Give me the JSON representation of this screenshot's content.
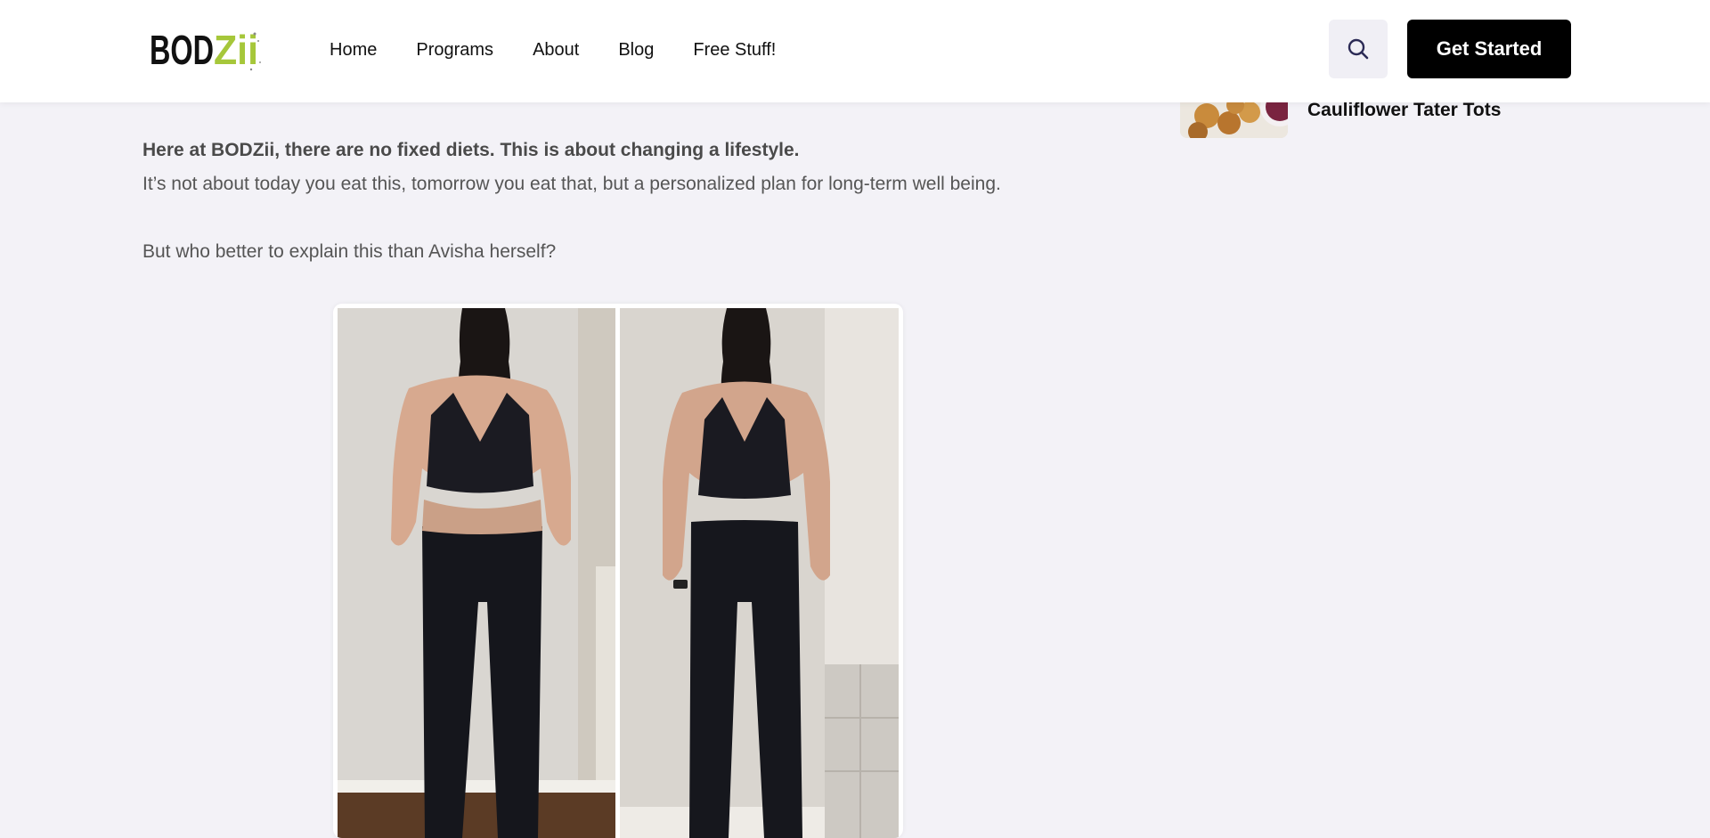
{
  "header": {
    "logo_text": "BODZii",
    "nav": [
      {
        "label": "Home"
      },
      {
        "label": "Programs"
      },
      {
        "label": "About"
      },
      {
        "label": "Blog"
      },
      {
        "label": "Free Stuff!"
      }
    ],
    "search_icon": "search-icon",
    "cta_label": "Get Started"
  },
  "sidebar": {
    "recipe": {
      "title": "Cauliflower Tater Tots"
    }
  },
  "article": {
    "intro_bold": "Here at BODZii, there are no fixed diets. This is about changing a lifestyle.",
    "intro_text": "It’s not about today you eat this, tomorrow you eat that, but a personalized plan for long-term well being.",
    "question": "But who better to explain this than Avisha herself?"
  },
  "colors": {
    "logo_accent": "#a6c73a",
    "cta_background": "#000000",
    "page_background": "#f3f2f7"
  }
}
